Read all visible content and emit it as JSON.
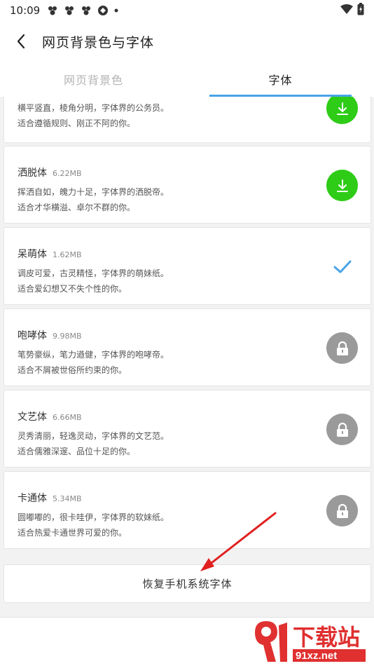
{
  "status_bar": {
    "time": "10:09",
    "icons": [
      "notification-icon",
      "notification-icon",
      "notification-icon",
      "app-icon",
      "dot-icon"
    ],
    "right_icons": [
      "wifi-icon",
      "battery-charging-icon"
    ]
  },
  "app_bar": {
    "title": "网页背景色与字体",
    "back_icon": "chevron-left-icon"
  },
  "tabs": [
    {
      "label": "网页背景色",
      "active": false
    },
    {
      "label": "字体",
      "active": true
    }
  ],
  "fonts": [
    {
      "name": "",
      "size": "",
      "desc1": "横平竖直，棱角分明，字体界的公务员。",
      "desc2": "适合遵循规则、刚正不阿的你。",
      "action": "download"
    },
    {
      "name": "洒脱体",
      "size": "6.22MB",
      "desc1": "挥洒自如，魄力十足，字体界的洒脱帝。",
      "desc2": "适合才华横溢、卓尔不群的你。",
      "action": "download"
    },
    {
      "name": "呆萌体",
      "size": "1.62MB",
      "desc1": "调皮可爱，古灵精怪，字体界的萌妹纸。",
      "desc2": "适合爱幻想又不失个性的你。",
      "action": "selected"
    },
    {
      "name": "咆哮体",
      "size": "9.98MB",
      "desc1": "笔势豪纵，笔力遒健，字体界的咆哮帝。",
      "desc2": "适合不屑被世俗所约束的你。",
      "action": "locked"
    },
    {
      "name": "文艺体",
      "size": "6.66MB",
      "desc1": "灵秀清丽，轻逸灵动，字体界的文艺范。",
      "desc2": "适合儒雅深邃、品位十足的你。",
      "action": "locked"
    },
    {
      "name": "卡通体",
      "size": "5.34MB",
      "desc1": "圆嘟嘟的，很卡哇伊，字体界的软妹纸。",
      "desc2": "适合热爱卡通世界可爱的你。",
      "action": "locked"
    }
  ],
  "restore_button": "恢复手机系统字体",
  "watermark": {
    "main": "下载站",
    "sub": "91xz.net"
  },
  "colors": {
    "accent": "#4aa4e8",
    "download": "#2ecc17",
    "locked": "#9a9a9a",
    "arrow": "#e02020"
  }
}
